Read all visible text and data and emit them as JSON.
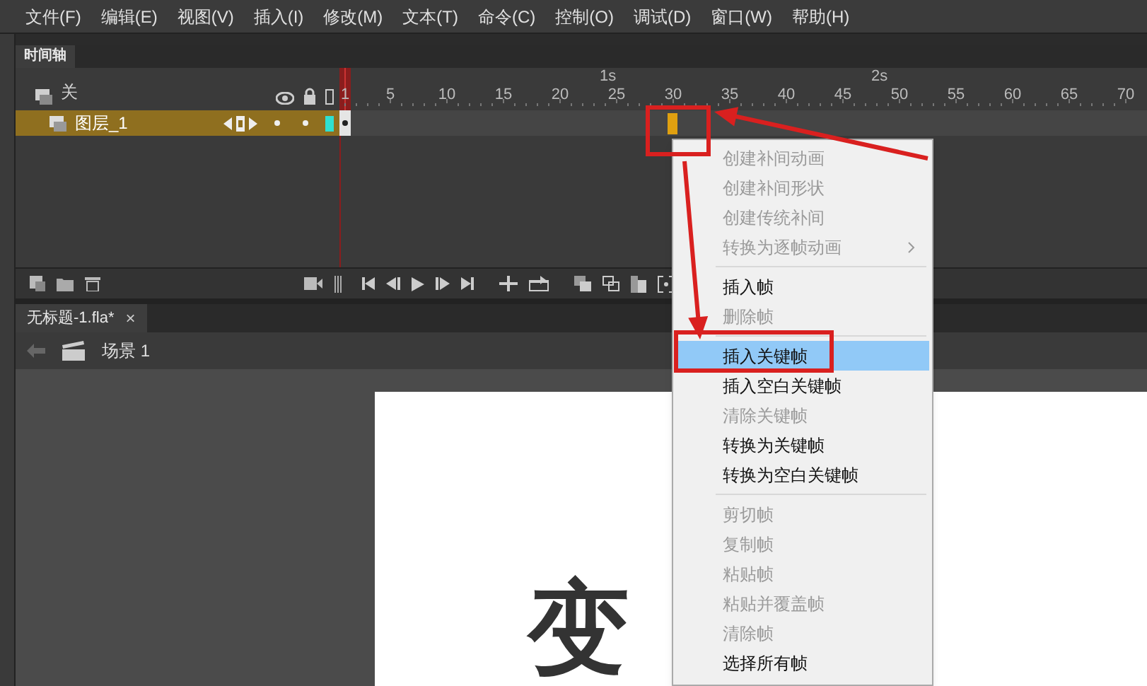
{
  "menu_bar": {
    "items": [
      "文件(F)",
      "编辑(E)",
      "视图(V)",
      "插入(I)",
      "修改(M)",
      "文本(T)",
      "命令(C)",
      "控制(O)",
      "调试(D)",
      "窗口(W)",
      "帮助(H)"
    ]
  },
  "timeline": {
    "tab": "时间轴",
    "header_label": "关",
    "ruler_numbers": [
      "1",
      "5",
      "10",
      "15",
      "20",
      "25",
      "30",
      "35",
      "40",
      "45",
      "50",
      "55",
      "60",
      "65",
      "70"
    ],
    "seconds": [
      "1s",
      "2s"
    ],
    "layers": [
      {
        "name": "图层_1",
        "selected": true
      }
    ]
  },
  "document_tab": {
    "title": "无标题-1.fla*",
    "close": "×"
  },
  "breadcrumb": {
    "scene": "场景 1"
  },
  "stage": {
    "text": "变"
  },
  "context_menu": {
    "items": [
      {
        "kind": "item",
        "label": "创建补间动画",
        "disabled": true,
        "selected": false,
        "submenu": false
      },
      {
        "kind": "item",
        "label": "创建补间形状",
        "disabled": true,
        "selected": false,
        "submenu": false
      },
      {
        "kind": "item",
        "label": "创建传统补间",
        "disabled": true,
        "selected": false,
        "submenu": false
      },
      {
        "kind": "item",
        "label": "转换为逐帧动画",
        "disabled": true,
        "selected": false,
        "submenu": true
      },
      {
        "kind": "separator"
      },
      {
        "kind": "item",
        "label": "插入帧",
        "disabled": false,
        "selected": false,
        "submenu": false
      },
      {
        "kind": "item",
        "label": "删除帧",
        "disabled": true,
        "selected": false,
        "submenu": false
      },
      {
        "kind": "separator"
      },
      {
        "kind": "item",
        "label": "插入关键帧",
        "disabled": false,
        "selected": true,
        "submenu": false
      },
      {
        "kind": "item",
        "label": "插入空白关键帧",
        "disabled": false,
        "selected": false,
        "submenu": false
      },
      {
        "kind": "item",
        "label": "清除关键帧",
        "disabled": true,
        "selected": false,
        "submenu": false
      },
      {
        "kind": "item",
        "label": "转换为关键帧",
        "disabled": false,
        "selected": false,
        "submenu": false
      },
      {
        "kind": "item",
        "label": "转换为空白关键帧",
        "disabled": false,
        "selected": false,
        "submenu": false
      },
      {
        "kind": "separator"
      },
      {
        "kind": "item",
        "label": "剪切帧",
        "disabled": true,
        "selected": false,
        "submenu": false
      },
      {
        "kind": "item",
        "label": "复制帧",
        "disabled": true,
        "selected": false,
        "submenu": false
      },
      {
        "kind": "item",
        "label": "粘贴帧",
        "disabled": true,
        "selected": false,
        "submenu": false
      },
      {
        "kind": "item",
        "label": "粘贴并覆盖帧",
        "disabled": true,
        "selected": false,
        "submenu": false
      },
      {
        "kind": "item",
        "label": "清除帧",
        "disabled": true,
        "selected": false,
        "submenu": false
      },
      {
        "kind": "item",
        "label": "选择所有帧",
        "disabled": false,
        "selected": false,
        "submenu": false
      }
    ]
  }
}
